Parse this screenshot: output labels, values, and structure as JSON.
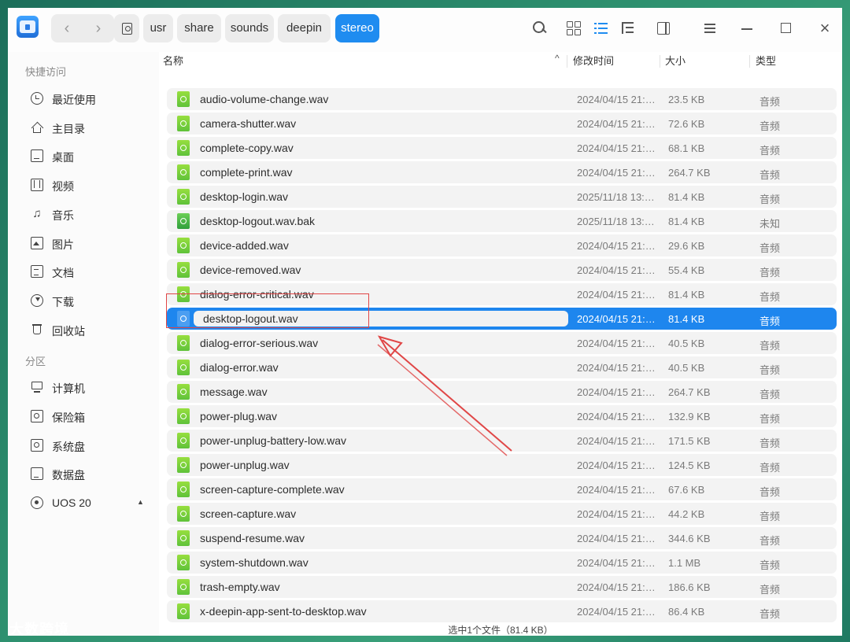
{
  "path": [
    "usr",
    "share",
    "sounds",
    "deepin",
    "stereo"
  ],
  "sidebar": {
    "quick_access_title": "快捷访问",
    "partitions_title": "分区",
    "items": [
      {
        "label": "最近使用",
        "icon": "clock-icon"
      },
      {
        "label": "主目录",
        "icon": "home-icon"
      },
      {
        "label": "桌面",
        "icon": "desktop-icon"
      },
      {
        "label": "视频",
        "icon": "video-icon"
      },
      {
        "label": "音乐",
        "icon": "music-icon"
      },
      {
        "label": "图片",
        "icon": "picture-icon"
      },
      {
        "label": "文档",
        "icon": "document-icon"
      },
      {
        "label": "下载",
        "icon": "download-icon"
      },
      {
        "label": "回收站",
        "icon": "trash-icon"
      }
    ],
    "partitions": [
      {
        "label": "计算机",
        "icon": "computer-icon"
      },
      {
        "label": "保险箱",
        "icon": "safe-icon"
      },
      {
        "label": "系统盘",
        "icon": "system-disk-icon"
      },
      {
        "label": "数据盘",
        "icon": "data-disk-icon"
      },
      {
        "label": "UOS 20",
        "icon": "cd-icon"
      }
    ]
  },
  "columns": {
    "name": "名称",
    "modified": "修改时间",
    "size": "大小",
    "type": "类型"
  },
  "files": [
    {
      "name": "audio-volume-change.wav",
      "modified": "2024/04/15 21:…",
      "size": "23.5 KB",
      "type": "音频"
    },
    {
      "name": "camera-shutter.wav",
      "modified": "2024/04/15 21:…",
      "size": "72.6 KB",
      "type": "音频"
    },
    {
      "name": "complete-copy.wav",
      "modified": "2024/04/15 21:…",
      "size": "68.1 KB",
      "type": "音频"
    },
    {
      "name": "complete-print.wav",
      "modified": "2024/04/15 21:…",
      "size": "264.7 KB",
      "type": "音频"
    },
    {
      "name": "desktop-login.wav",
      "modified": "2025/11/18 13:…",
      "size": "81.4 KB",
      "type": "音频"
    },
    {
      "name": "desktop-logout.wav.bak",
      "modified": "2025/11/18 13:…",
      "size": "81.4 KB",
      "type": "未知"
    },
    {
      "name": "device-added.wav",
      "modified": "2024/04/15 21:…",
      "size": "29.6 KB",
      "type": "音频"
    },
    {
      "name": "device-removed.wav",
      "modified": "2024/04/15 21:…",
      "size": "55.4 KB",
      "type": "音频"
    },
    {
      "name": "dialog-error-critical.wav",
      "modified": "2024/04/15 21:…",
      "size": "81.4 KB",
      "type": "音频"
    },
    {
      "name": "desktop-logout.wav",
      "modified": "2024/04/15 21:…",
      "size": "81.4 KB",
      "type": "音频",
      "selected": true
    },
    {
      "name": "dialog-error-serious.wav",
      "modified": "2024/04/15 21:…",
      "size": "40.5 KB",
      "type": "音频"
    },
    {
      "name": "dialog-error.wav",
      "modified": "2024/04/15 21:…",
      "size": "40.5 KB",
      "type": "音频"
    },
    {
      "name": "message.wav",
      "modified": "2024/04/15 21:…",
      "size": "264.7 KB",
      "type": "音频"
    },
    {
      "name": "power-plug.wav",
      "modified": "2024/04/15 21:…",
      "size": "132.9 KB",
      "type": "音频"
    },
    {
      "name": "power-unplug-battery-low.wav",
      "modified": "2024/04/15 21:…",
      "size": "171.5 KB",
      "type": "音频"
    },
    {
      "name": "power-unplug.wav",
      "modified": "2024/04/15 21:…",
      "size": "124.5 KB",
      "type": "音频"
    },
    {
      "name": "screen-capture-complete.wav",
      "modified": "2024/04/15 21:…",
      "size": "67.6 KB",
      "type": "音频"
    },
    {
      "name": "screen-capture.wav",
      "modified": "2024/04/15 21:…",
      "size": "44.2 KB",
      "type": "音频"
    },
    {
      "name": "suspend-resume.wav",
      "modified": "2024/04/15 21:…",
      "size": "344.6 KB",
      "type": "音频"
    },
    {
      "name": "system-shutdown.wav",
      "modified": "2024/04/15 21:…",
      "size": "1.1 MB",
      "type": "音频"
    },
    {
      "name": "trash-empty.wav",
      "modified": "2024/04/15 21:…",
      "size": "186.6 KB",
      "type": "音频"
    },
    {
      "name": "x-deepin-app-sent-to-desktop.wav",
      "modified": "2024/04/15 21:…",
      "size": "86.4 KB",
      "type": "音频"
    }
  ],
  "status_text": "选中1个文件（81.4 KB）",
  "watermark": "大数跨境",
  "colors": {
    "accent": "#1f8cf0",
    "selected_row": "#1e86ee",
    "annotation": "#e04646",
    "audio_icon": "#7fd33c"
  }
}
